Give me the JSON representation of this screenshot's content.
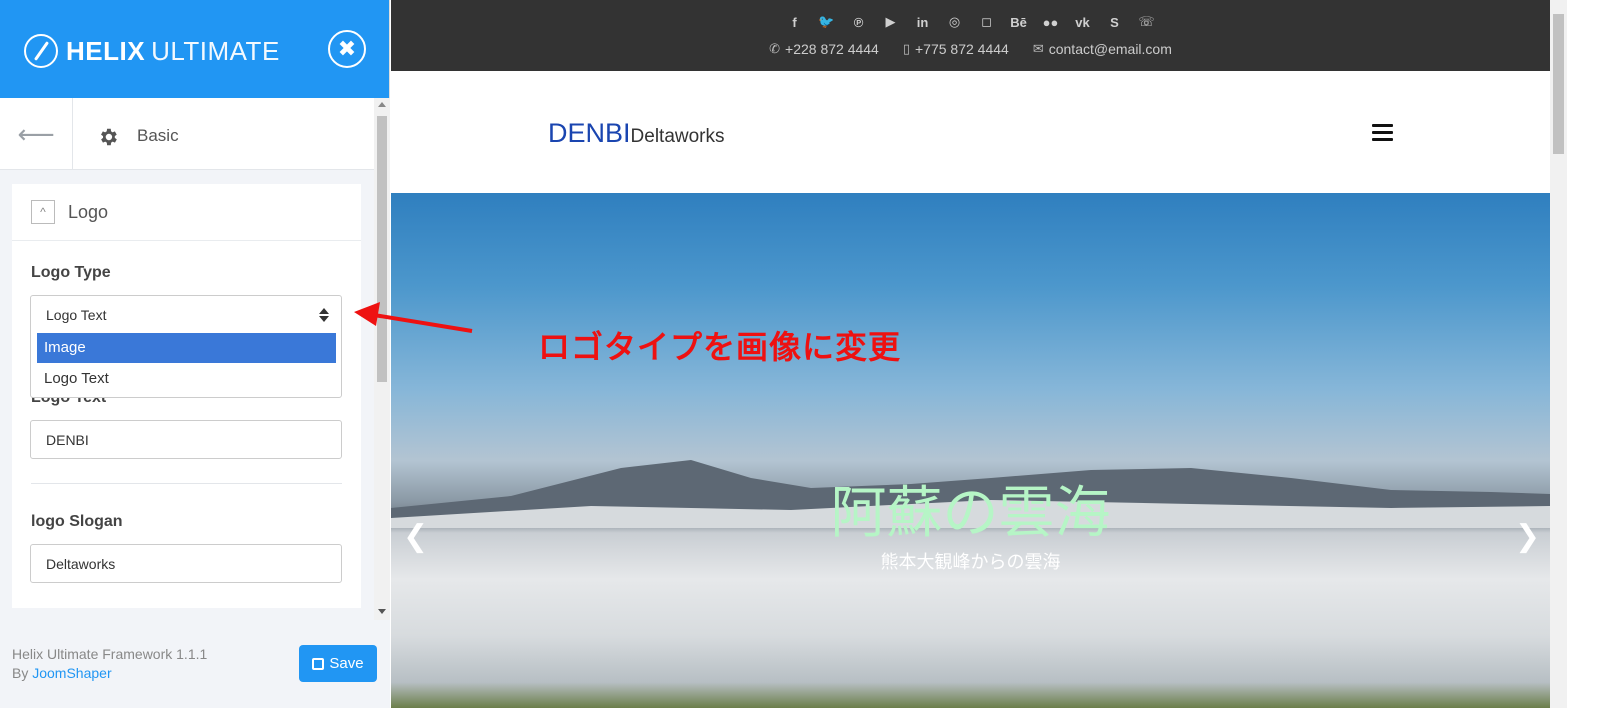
{
  "panel": {
    "brand_bold": "HELIX",
    "brand_light": "ULTIMATE",
    "close_glyph": "✖",
    "nav": {
      "back_glyph": "⟵",
      "title": "Basic"
    },
    "section": {
      "title": "Logo",
      "collapse_glyph": "^",
      "logo_type_label": "Logo Type",
      "logo_type_selected": "Logo Text",
      "logo_type_options": [
        "Image",
        "Logo Text"
      ],
      "logo_text_label": "Logo Text",
      "logo_text_value": "DENBI",
      "slogan_label": "logo Slogan",
      "slogan_value": "Deltaworks"
    },
    "footer": {
      "version": "Helix Ultimate Framework 1.1.1",
      "by": "By ",
      "by_link": "JoomShaper",
      "save_label": "Save"
    }
  },
  "site": {
    "socials": [
      {
        "icon": "facebook-icon",
        "glyph": "f"
      },
      {
        "icon": "twitter-icon",
        "glyph": "🐦"
      },
      {
        "icon": "pinterest-icon",
        "glyph": "℗"
      },
      {
        "icon": "youtube-icon",
        "glyph": "▶"
      },
      {
        "icon": "linkedin-icon",
        "glyph": "in"
      },
      {
        "icon": "dribbble-icon",
        "glyph": "◎"
      },
      {
        "icon": "instagram-icon",
        "glyph": "◻"
      },
      {
        "icon": "behance-icon",
        "glyph": "Bē"
      },
      {
        "icon": "flickr-icon",
        "glyph": "●●"
      },
      {
        "icon": "vk-icon",
        "glyph": "vk"
      },
      {
        "icon": "skype-icon",
        "glyph": "S"
      },
      {
        "icon": "whatsapp-icon",
        "glyph": "☏"
      }
    ],
    "contacts": {
      "phone": "+228 872 4444",
      "mobile": "+775 872 4444",
      "email": "contact@email.com"
    },
    "logo_main": "DENBI",
    "logo_slogan": "Deltaworks",
    "hero_title": "阿蘇の雲海",
    "hero_subtitle": "熊本大観峰からの雲海"
  },
  "annotation": {
    "text": "ロゴタイプを画像に変更",
    "color": "#ee1111"
  },
  "colors": {
    "accent": "#2196f3",
    "selected_option": "#3a78d8",
    "topbar": "#333333",
    "site_logo": "#1a45b0"
  }
}
